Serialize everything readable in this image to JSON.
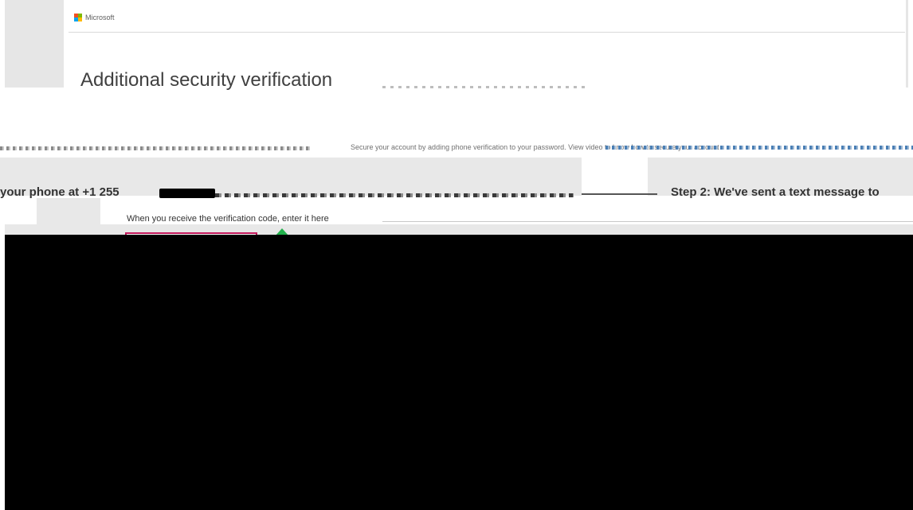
{
  "header": {
    "brand": "Microsoft",
    "title": "Additional security verification"
  },
  "intro": {
    "text": "Secure your account by adding phone verification to your password. View video to know how to secure your account"
  },
  "steps": {
    "step1_text": "your phone at +1 255",
    "step2_text": "Step 2: We've sent a text message to"
  },
  "verification": {
    "label": "When you receive the verification code, enter it here",
    "code_value": ""
  },
  "colors": {
    "logo_red": "#f25022",
    "logo_green": "#7fba00",
    "logo_blue": "#00a4ef",
    "logo_yellow": "#ffb900",
    "input_border": "#c2185b",
    "arrow": "#22b14c"
  }
}
